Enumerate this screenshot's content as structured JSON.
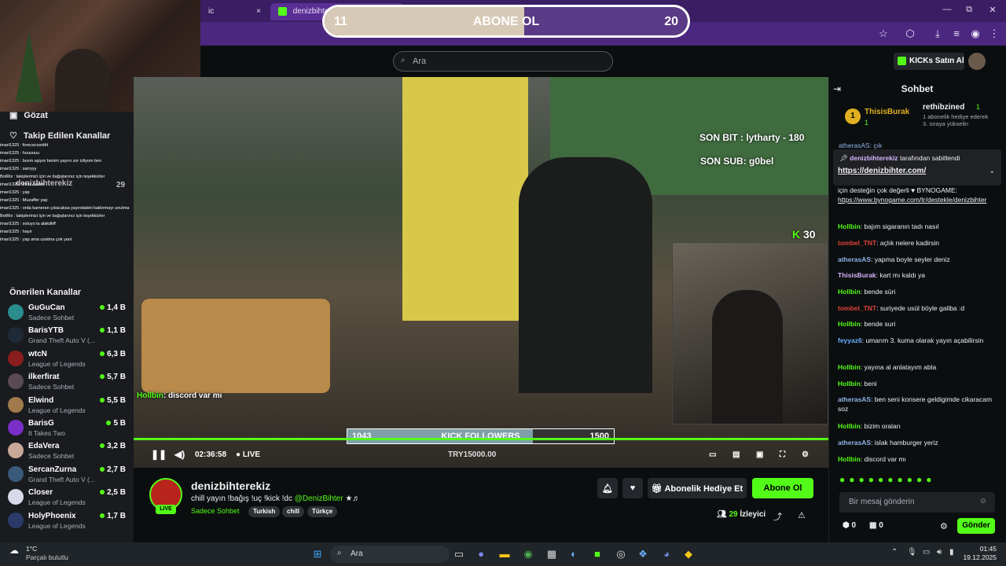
{
  "browser": {
    "tab1_label": "ic",
    "tab2_label": "denizbihterekiz",
    "tab_close": "×",
    "win_min": "—",
    "win_max": "⧉",
    "win_close": "✕"
  },
  "sub_goal": {
    "current": "11",
    "label": "ABONE OL",
    "target": "20",
    "progress": 0.55
  },
  "header": {
    "search_placeholder": "Ara",
    "buy_kicks_label": "KICKs Satın Al"
  },
  "sidebar": {
    "browse_label": "Gözat",
    "followed_label": "Takip Edilen Kanallar",
    "followed_channel": {
      "name": "denizbihterekiz",
      "viewers": "29"
    },
    "recommended_label": "Önerilen Kanallar",
    "channels": [
      {
        "name": "GuGuCan",
        "category": "Sadece Sohbet",
        "viewers": "1,4 B",
        "color": "#2a8c8c"
      },
      {
        "name": "BarisYTB",
        "category": "Grand Theft Auto V (...",
        "viewers": "1,1 B",
        "color": "#1e2a38"
      },
      {
        "name": "wtcN",
        "category": "League of Legends",
        "viewers": "6,3 B",
        "color": "#8a1e1e"
      },
      {
        "name": "ilkerfirat",
        "category": "Sadece Sohbet",
        "viewers": "5,7 B",
        "color": "#5a4a52"
      },
      {
        "name": "Elwind",
        "category": "League of Legends",
        "viewers": "5,5 B",
        "color": "#a07a4a"
      },
      {
        "name": "BarisG",
        "category": "It Takes Two",
        "viewers": "5 B",
        "color": "#7a2fc8"
      },
      {
        "name": "EdaVera",
        "category": "Sadece Sohbet",
        "viewers": "3,2 B",
        "color": "#c8a898"
      },
      {
        "name": "SercanZurna",
        "category": "Grand Theft Auto V (...",
        "viewers": "2,7 B",
        "color": "#3a5a7a"
      },
      {
        "name": "Closer",
        "category": "League of Legends",
        "viewers": "2,5 B",
        "color": "#d8d8e8"
      },
      {
        "name": "HolyPhoenix",
        "category": "League of Legends",
        "viewers": "1,7 B",
        "color": "#2a3a6a"
      }
    ]
  },
  "overlay_chat": [
    "imari1325 : forececssstttt",
    "imari1325 : huuuuuu",
    "imari1325 : bısım aşiyor benim yayını zor izliyom ben",
    "imari1325 : sarryyy",
    "BotRix : takiplerinizi için ve bağışlarınız için teşekkürler",
    "imari1325 : iriniz neden",
    "imari1325 : yap",
    "imari1325 : Muzaffer yap",
    "imari1325 : orda kameran çıkacaksa yayındakini kaldırmayı unutma",
    "BotRix : takiplerinizi için ve bağışlarınız için teşekkürler",
    "imari1325 : soluyo la alakdkff",
    "imari1325 : hayır",
    "imari1325 : yap ama uzatma çok yani"
  ],
  "video": {
    "last_bit": "SON BIT : lytharty - 180",
    "last_sub": "SON SUB: g0bel",
    "kick_count": "30",
    "chat_overlay_user": "Hollbin",
    "chat_overlay_text": ": discord var mı",
    "follow_goal": {
      "current": "1043",
      "label": "KICK FOLLOWERS",
      "target": "1500",
      "progress": 0.695
    },
    "donation_text": "TRY15000.00",
    "time": "02:36:58",
    "live_label": "LIVE"
  },
  "stream": {
    "streamer_name": "denizbihterekiz",
    "title": "chill yayın !bağış !uç !kick !dc",
    "title_mention": "@DenizBihter",
    "title_suffix": "★♬",
    "category": "Sadece Sohbet",
    "tags": [
      "Turkish",
      "chill",
      "Türkçe"
    ],
    "live_badge": "LIVE",
    "gift_sub_label": "Abonelik Hediye Et",
    "subscribe_label": "Abone Ol",
    "viewer_count": "29",
    "viewer_label": "İzleyici"
  },
  "chat": {
    "title": "Sohbet",
    "leader1_name": "ThisisBurak",
    "leader1_rank": "1",
    "leader1_count": "1",
    "leader2_name": "rethibzined",
    "leader2_count": "1",
    "leader2_desc": "1 abonelik hediye ederek 3. sıraya yükselin",
    "pinned_by": "denizbihterekiz",
    "pinned_suffix": "tarafından sabitlendi",
    "pinned_link": "https://denizbihter.com/",
    "messages": [
      {
        "user": "",
        "text": "için desteğin çok değerli ♥ BYNOGAME:",
        "color": "#efeff1"
      },
      {
        "user": "",
        "text": "https://www.bynogame.com/tr/destekle/denizbihter",
        "color": "#efeff1"
      },
      {
        "user": "Hollbin",
        "text": ": bajım sigaranın tadı nasıl",
        "color": "#53fc18"
      },
      {
        "user": "tombel_TNT",
        "text": ": açlık nelere kadirsin",
        "color": "#e0443c"
      },
      {
        "user": "atherasAS",
        "text": ": yapma boyle seyler deniz",
        "color": "#8fb4e8"
      },
      {
        "user": "ThisisBurak",
        "text": ": kart mı kaldı ya",
        "color": "#d5b3ff"
      },
      {
        "user": "Hollbin",
        "text": ": bende süri",
        "color": "#53fc18"
      },
      {
        "user": "tombel_TNT",
        "text": ": suriyede usül böyle galiba :d",
        "color": "#e0443c"
      },
      {
        "user": "Hollbin",
        "text": ": bende suri",
        "color": "#53fc18"
      },
      {
        "user": "feyyaz6",
        "text": ": umarım 3. kuma olarak yayın açabilirsin",
        "color": "#6ab0ff"
      },
      {
        "user": "Hollbin",
        "text": ": yayına al anlatayım abla",
        "color": "#53fc18"
      },
      {
        "user": "Hollbin",
        "text": ": beni",
        "color": "#53fc18"
      },
      {
        "user": "atherasAS",
        "text": ": ben seni konsere geldigimde cikaracam soz",
        "color": "#8fb4e8"
      },
      {
        "user": "Hollbin",
        "text": ": bizim oraları",
        "color": "#53fc18"
      },
      {
        "user": "atherasAS",
        "text": ": islak hamburger yeriz",
        "color": "#8fb4e8"
      },
      {
        "user": "Hollbin",
        "text": ": discord var mı",
        "color": "#53fc18"
      }
    ],
    "input_placeholder": "Bir mesaj gönderin",
    "send_label": "Gönder",
    "kicks_count": "0",
    "gift_count": "0",
    "top_partial": "atherasAS: çık"
  },
  "taskbar": {
    "weather_temp": "1°C",
    "weather_desc": "Parçalı bulutlu",
    "search_label": "Ara",
    "time": "01:45",
    "date": "19.12.2025"
  }
}
